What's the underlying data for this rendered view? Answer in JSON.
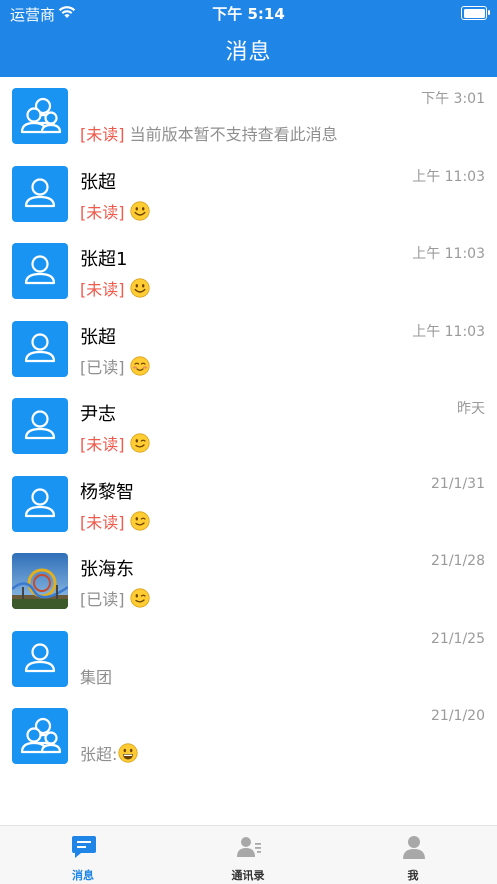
{
  "status_bar": {
    "carrier": "运营商",
    "time": "下午 5:14"
  },
  "header": {
    "title": "消息"
  },
  "colors": {
    "brand": "#1f85e6",
    "avatar": "#1a94f2",
    "unread": "#ef5a4c",
    "muted": "#8f8f8f",
    "tab_active": "#1f85e6",
    "tab_inactive": "#a8a8a8"
  },
  "conversations": [
    {
      "name": "",
      "time": "下午 3:01",
      "tag": "[未读]",
      "text": " 当前版本暂不支持查看此消息",
      "emoji": "",
      "avatar": "group"
    },
    {
      "name": "张超",
      "time": "上午 11:03",
      "tag": "[未读]",
      "text": "",
      "emoji": "smile",
      "avatar": "person"
    },
    {
      "name": "张超1",
      "time": "上午 11:03",
      "tag": "[未读]",
      "text": "",
      "emoji": "smile",
      "avatar": "person"
    },
    {
      "name": "张超",
      "time": "上午 11:03",
      "tag": "[已读]",
      "text": "",
      "emoji": "blush",
      "avatar": "person"
    },
    {
      "name": "尹志",
      "time": "昨天",
      "tag": "[未读]",
      "text": "",
      "emoji": "wink",
      "avatar": "person"
    },
    {
      "name": "杨黎智",
      "time": "21/1/31",
      "tag": "[未读]",
      "text": "",
      "emoji": "wink",
      "avatar": "person"
    },
    {
      "name": "张海东",
      "time": "21/1/28",
      "tag": "[已读]",
      "text": "",
      "emoji": "wink",
      "avatar": "photo"
    },
    {
      "name": "",
      "time": "21/1/25",
      "tag": "",
      "text": "集团",
      "emoji": "",
      "avatar": "person"
    },
    {
      "name": "",
      "time": "21/1/20",
      "tag": "",
      "text": "张超:",
      "emoji": "grin",
      "avatar": "group"
    }
  ],
  "tabbar": {
    "tabs": [
      {
        "label": "消息",
        "icon": "chat-bubble-icon",
        "active": true
      },
      {
        "label": "通讯录",
        "icon": "contacts-icon",
        "active": false
      },
      {
        "label": "我",
        "icon": "person-icon",
        "active": false
      }
    ]
  }
}
